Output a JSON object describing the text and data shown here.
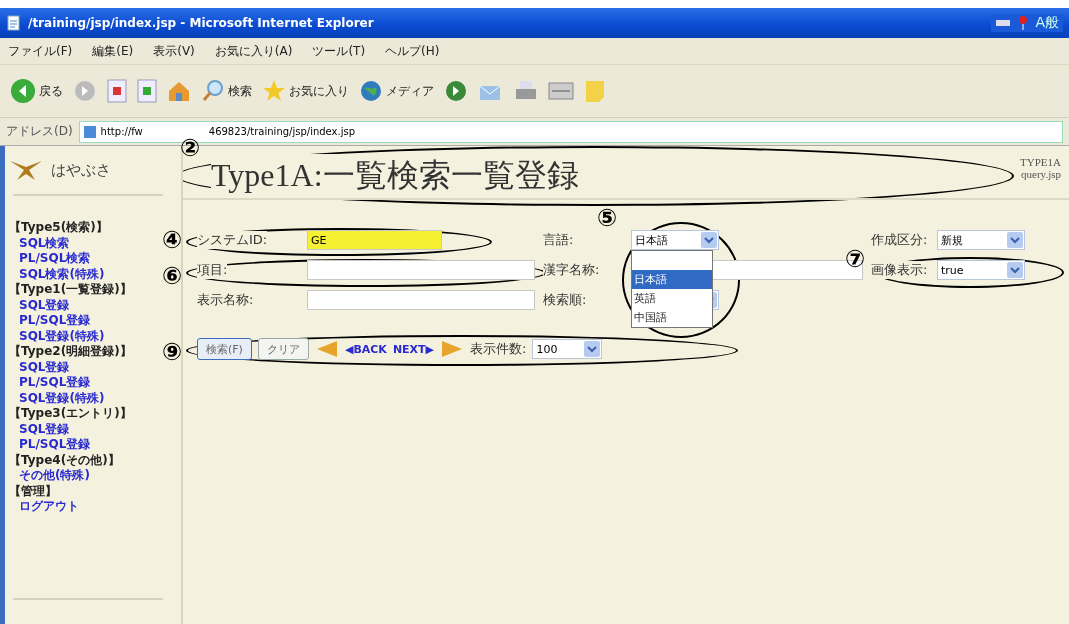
{
  "window": {
    "title": "/training/jsp/index.jsp - Microsoft Internet Explorer",
    "tray_text": "A般"
  },
  "menu": [
    "ファイル(F)",
    "編集(E)",
    "表示(V)",
    "お気に入り(A)",
    "ツール(T)",
    "ヘルプ(H)"
  ],
  "toolbar": [
    {
      "kind": "back",
      "label": "戻る"
    },
    {
      "kind": "forward"
    },
    {
      "kind": "stop"
    },
    {
      "kind": "refresh"
    },
    {
      "kind": "home"
    },
    {
      "kind": "search",
      "label": "検索"
    },
    {
      "kind": "favorites",
      "label": "お気に入り"
    },
    {
      "kind": "media",
      "label": "メディア"
    },
    {
      "kind": "history"
    },
    {
      "kind": "mail"
    },
    {
      "kind": "print"
    },
    {
      "kind": "edit"
    },
    {
      "kind": "note"
    }
  ],
  "address": {
    "label": "アドレス(D)",
    "url_parts": [
      "http://fw",
      "469823/training/jsp/index.jsp"
    ]
  },
  "sidebar": {
    "logo": "はやぶさ",
    "groups": [
      {
        "title": "【Type5(検索)】",
        "links": [
          "SQL検索",
          "PL/SQL検索",
          "SQL検索(特殊)"
        ]
      },
      {
        "title": "【Type1(一覧登録)】",
        "links": [
          "SQL登録",
          "PL/SQL登録",
          "SQL登録(特殊)"
        ]
      },
      {
        "title": "【Type2(明細登録)】",
        "links": [
          "SQL登録",
          "PL/SQL登録",
          "SQL登録(特殊)"
        ]
      },
      {
        "title": "【Type3(エントリ)】",
        "links": [
          "SQL登録",
          "PL/SQL登録"
        ]
      },
      {
        "title": "【Type4(その他)】",
        "links": [
          "その他(特殊)"
        ]
      },
      {
        "title": "【管理】",
        "links": [
          "ログアウト"
        ]
      }
    ]
  },
  "page": {
    "title": "Type1A:一覧検索一覧登録",
    "code": "TYPE1A",
    "file": "query.jsp"
  },
  "form": {
    "rows": [
      [
        {
          "kind": "text",
          "label": "システムID:",
          "value": "GE",
          "highlighted": true
        },
        {
          "kind": "select",
          "label": "言語:",
          "value": "日本語"
        },
        {
          "kind": "select",
          "label": "作成区分:",
          "value": "新規"
        }
      ],
      [
        {
          "kind": "text",
          "label": "項目:",
          "highlighted": false
        },
        {
          "kind": "text",
          "label": "漢字名称:",
          "highlighted": false
        },
        {
          "kind": "select",
          "label": "画像表示:",
          "value": "true"
        }
      ],
      [
        {
          "kind": "text",
          "label": "表示名称:",
          "highlighted": false
        },
        {
          "kind": "select",
          "label": "検索順:"
        }
      ]
    ],
    "language_options": [
      {
        "label": "日本語",
        "selected": true
      },
      {
        "label": "英語",
        "selected": false
      },
      {
        "label": "中国語",
        "selected": false
      }
    ],
    "buttons": [
      "検索(F)",
      "クリア"
    ],
    "back": "◀BACK",
    "next": "NEXT▶",
    "count_label": "表示件数:",
    "count_value": "100"
  },
  "annotations": [
    "②",
    "④",
    "⑤",
    "⑥",
    "⑦",
    "⑨"
  ]
}
